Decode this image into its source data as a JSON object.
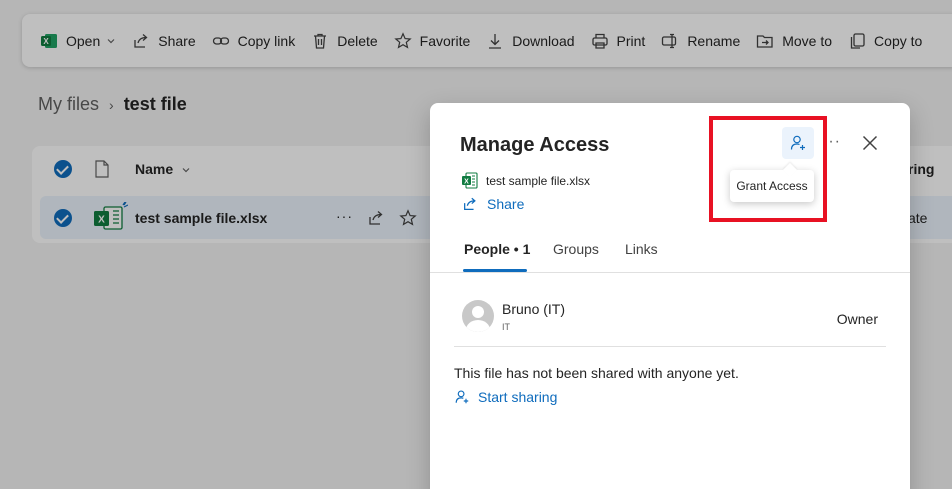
{
  "toolbar": {
    "items": [
      {
        "label": "Open",
        "icon": "excel-icon"
      },
      {
        "label": "Share",
        "icon": "share-icon"
      },
      {
        "label": "Copy link",
        "icon": "link-icon"
      },
      {
        "label": "Delete",
        "icon": "trash-icon"
      },
      {
        "label": "Favorite",
        "icon": "star-icon"
      },
      {
        "label": "Download",
        "icon": "download-icon"
      },
      {
        "label": "Print",
        "icon": "print-icon"
      },
      {
        "label": "Rename",
        "icon": "rename-icon"
      },
      {
        "label": "Move to",
        "icon": "move-icon"
      },
      {
        "label": "Copy to",
        "icon": "copy-icon"
      }
    ]
  },
  "breadcrumb": {
    "root": "My files",
    "separator": "›",
    "current": "test file"
  },
  "file_list": {
    "name_header": "Name",
    "right_header_fragment": "ring",
    "rows": [
      {
        "name": "test sample file.xlsx",
        "right_fragment": "ate"
      }
    ]
  },
  "dialog": {
    "title": "Manage Access",
    "file_name": "test sample file.xlsx",
    "share_label": "Share",
    "grant_tooltip": "Grant Access",
    "more_label": "···",
    "tabs": [
      {
        "label": "People • 1",
        "active": true
      },
      {
        "label": "Groups",
        "active": false
      },
      {
        "label": "Links",
        "active": false
      }
    ],
    "people": [
      {
        "name": "Bruno (IT)",
        "subtitle": "IT",
        "role": "Owner"
      }
    ],
    "empty_message": "This file has not been shared with anyone yet.",
    "start_sharing_label": "Start sharing"
  },
  "colors": {
    "accent": "#0f6cbd",
    "excel_green": "#107c41",
    "highlight_red": "#e81123"
  }
}
